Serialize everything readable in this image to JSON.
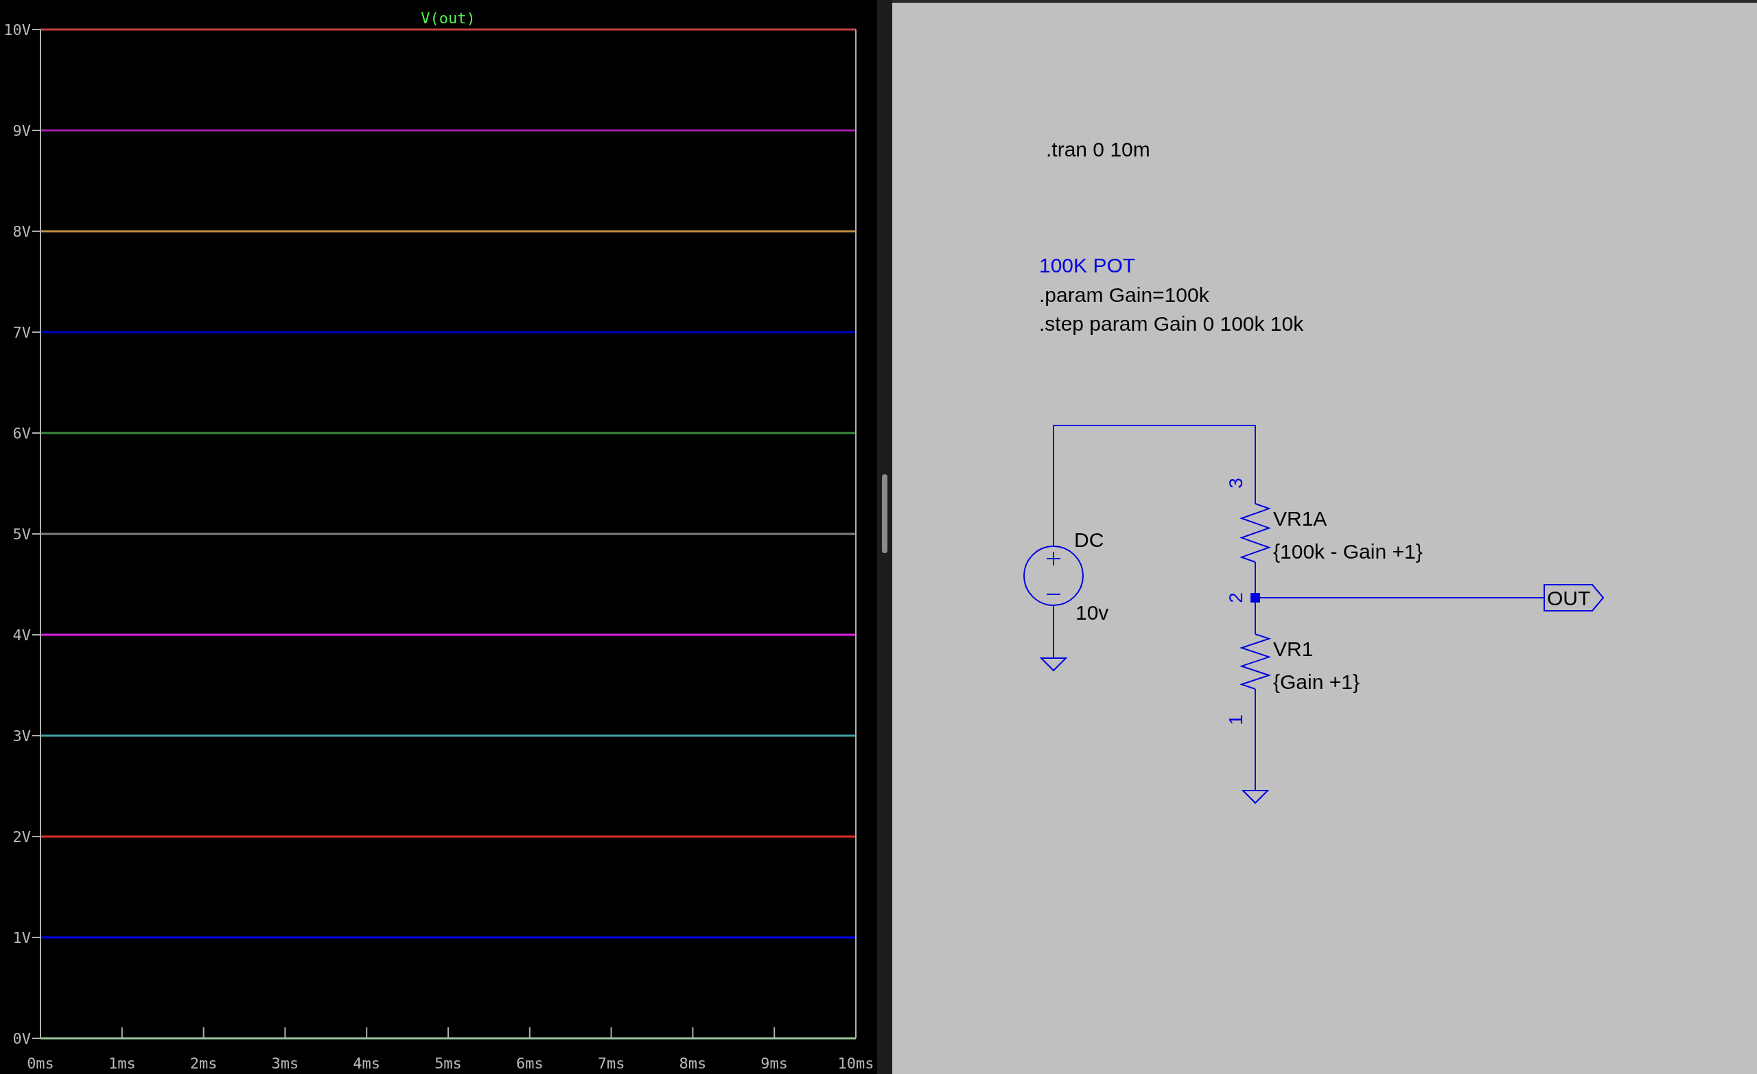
{
  "plot": {
    "chart_data": {
      "type": "line",
      "title": "V(out)",
      "x": [
        0,
        10
      ],
      "xlim": [
        0,
        10
      ],
      "ylim": [
        0,
        10
      ],
      "xticks": [
        {
          "value": 0,
          "label": "0ms"
        },
        {
          "value": 1,
          "label": "1ms"
        },
        {
          "value": 2,
          "label": "2ms"
        },
        {
          "value": 3,
          "label": "3ms"
        },
        {
          "value": 4,
          "label": "4ms"
        },
        {
          "value": 5,
          "label": "5ms"
        },
        {
          "value": 6,
          "label": "6ms"
        },
        {
          "value": 7,
          "label": "7ms"
        },
        {
          "value": 8,
          "label": "8ms"
        },
        {
          "value": 9,
          "label": "9ms"
        },
        {
          "value": 10,
          "label": "10ms"
        }
      ],
      "yticks": [
        {
          "value": 0,
          "label": "0V"
        },
        {
          "value": 1,
          "label": "1V"
        },
        {
          "value": 2,
          "label": "2V"
        },
        {
          "value": 3,
          "label": "3V"
        },
        {
          "value": 4,
          "label": "4V"
        },
        {
          "value": 5,
          "label": "5V"
        },
        {
          "value": 6,
          "label": "6V"
        },
        {
          "value": 7,
          "label": "7V"
        },
        {
          "value": 8,
          "label": "8V"
        },
        {
          "value": 9,
          "label": "9V"
        },
        {
          "value": 10,
          "label": "10V"
        }
      ],
      "series": [
        {
          "color": "#80e080",
          "values": [
            0,
            0
          ]
        },
        {
          "color": "#0000f0",
          "values": [
            1,
            1
          ]
        },
        {
          "color": "#e03020",
          "values": [
            2,
            2
          ]
        },
        {
          "color": "#40a0a0",
          "values": [
            3,
            3
          ]
        },
        {
          "color": "#e020e0",
          "values": [
            4,
            4
          ]
        },
        {
          "color": "#808080",
          "values": [
            5,
            5
          ]
        },
        {
          "color": "#3a8a3a",
          "values": [
            6,
            6
          ]
        },
        {
          "color": "#0000c0",
          "values": [
            7,
            7
          ]
        },
        {
          "color": "#c09040",
          "values": [
            8,
            8
          ]
        },
        {
          "color": "#a020a0",
          "values": [
            9,
            9
          ]
        },
        {
          "color": "#c04040",
          "values": [
            10,
            10
          ]
        }
      ]
    }
  },
  "schematic": {
    "directives": [
      ".tran 0 10m"
    ],
    "comment": "100K POT",
    "params": [
      ".param Gain=100k",
      ".step param Gain 0 100k 10k"
    ],
    "source": {
      "name": "DC",
      "value": "10v"
    },
    "resistors": [
      {
        "name": "VR1A",
        "value": "{100k - Gain +1}"
      },
      {
        "name": "VR1",
        "value": "{Gain +1}"
      }
    ],
    "pins": [
      "3",
      "2",
      "1"
    ],
    "net_label": "OUT"
  }
}
